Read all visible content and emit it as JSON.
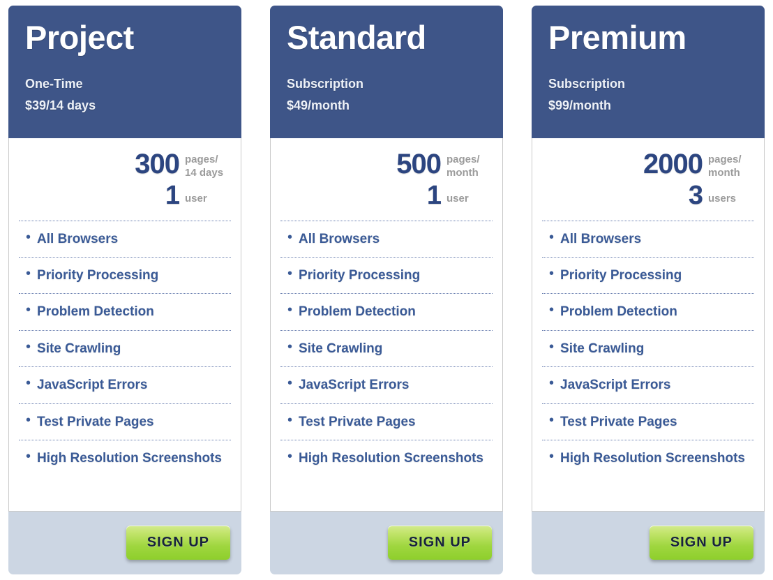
{
  "plans": [
    {
      "name": "Project",
      "billing": "One-Time",
      "price": "$39/14 days",
      "pages": "300",
      "pages_unit": "pages/\n14 days",
      "users": "1",
      "users_unit": "user",
      "features": [
        "All Browsers",
        "Priority Processing",
        "Problem Detection",
        "Site Crawling",
        "JavaScript Errors",
        "Test Private Pages",
        "High Resolution Screenshots"
      ],
      "cta": "SIGN UP"
    },
    {
      "name": "Standard",
      "billing": "Subscription",
      "price": "$49/month",
      "pages": "500",
      "pages_unit": "pages/\nmonth",
      "users": "1",
      "users_unit": "user",
      "features": [
        "All Browsers",
        "Priority Processing",
        "Problem Detection",
        "Site Crawling",
        "JavaScript Errors",
        "Test Private Pages",
        "High Resolution Screenshots"
      ],
      "cta": "SIGN UP"
    },
    {
      "name": "Premium",
      "billing": "Subscription",
      "price": "$99/month",
      "pages": "2000",
      "pages_unit": "pages/\nmonth",
      "users": "3",
      "users_unit": "users",
      "features": [
        "All Browsers",
        "Priority Processing",
        "Problem Detection",
        "Site Crawling",
        "JavaScript Errors",
        "Test Private Pages",
        "High Resolution Screenshots"
      ],
      "cta": "SIGN UP"
    }
  ],
  "colors": {
    "header_blue": "#3e5588",
    "number_blue": "#2c4580",
    "feature_blue": "#3a5a96",
    "unit_gray": "#9b9b9b",
    "footer_bg": "#ccd6e3",
    "cta_green": "#9fd63f"
  },
  "bullet_glyph": "•"
}
